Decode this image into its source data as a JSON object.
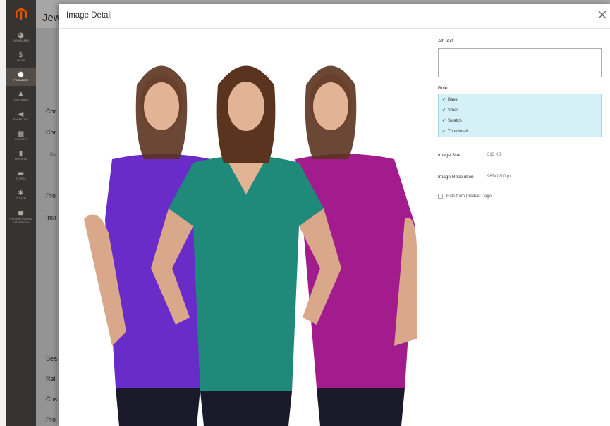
{
  "sidebar": {
    "items": [
      {
        "label": "DASHBOARD",
        "icon": "dashboard-icon",
        "glyph": "◕"
      },
      {
        "label": "SALES",
        "icon": "dollar-icon",
        "glyph": "$"
      },
      {
        "label": "PRODUCTS",
        "icon": "cube-icon",
        "glyph": "⬢"
      },
      {
        "label": "CUSTOMERS",
        "icon": "person-icon",
        "glyph": "♟"
      },
      {
        "label": "MARKETING",
        "icon": "megaphone-icon",
        "glyph": "◀"
      },
      {
        "label": "CONTENT",
        "icon": "layout-icon",
        "glyph": "▦"
      },
      {
        "label": "REPORTS",
        "icon": "bar-chart-icon",
        "glyph": "▮"
      },
      {
        "label": "STORES",
        "icon": "store-icon",
        "glyph": "▬"
      },
      {
        "label": "SYSTEM",
        "icon": "gear-icon",
        "glyph": "✱"
      },
      {
        "label": "FIND PARTNERS & EXTENSIONS",
        "icon": "extensions-icon",
        "glyph": "⬣"
      }
    ]
  },
  "page": {
    "title": "Jew",
    "labels": [
      "Cor",
      "Cor",
      "Co",
      "Pro",
      "Ima",
      "Sea",
      "Rel",
      "Cus",
      "Pro"
    ]
  },
  "modal": {
    "title": "Image Detail",
    "image": {
      "description_icon": "product-image",
      "shirt_colors": [
        "#6a2cc8",
        "#1f8a7a",
        "#a21c8e"
      ]
    },
    "alt_text": {
      "label": "Alt Text",
      "value": ""
    },
    "role": {
      "label": "Role",
      "options": [
        "Base",
        "Small",
        "Swatch",
        "Thumbnail"
      ]
    },
    "image_size": {
      "label": "Image Size",
      "value": "313 KB"
    },
    "image_resolution": {
      "label": "Image Resolution",
      "value": "967x1200 px"
    },
    "hide_from_product_page": {
      "label": "Hide from Product Page",
      "checked": false
    }
  },
  "colors": {
    "sidebar_bg": "#373330",
    "magento_orange": "#eb5202",
    "role_selected_bg": "#d6f0f8"
  }
}
